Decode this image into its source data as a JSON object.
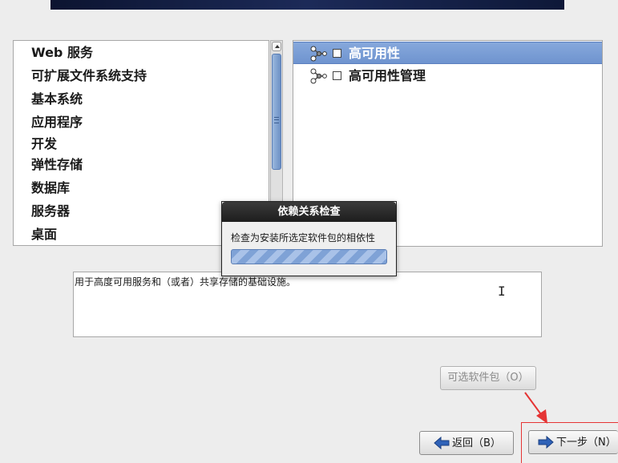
{
  "categories": [
    "Web 服务",
    "可扩展文件系统支持",
    "基本系统",
    "应用程序",
    "开发",
    "弹性存储",
    "数据库",
    "服务器",
    "桌面"
  ],
  "packages": [
    {
      "label": "高可用性",
      "selected": true,
      "checked": false,
      "icon": "package-group-icon"
    },
    {
      "label": "高可用性管理",
      "selected": false,
      "checked": false,
      "icon": "package-group-icon"
    }
  ],
  "description": "用于高度可用服务和（或者）共享存储的基础设施。",
  "dialog": {
    "title": "依赖关系检查",
    "message": "检查为安装所选定软件包的相依性",
    "progress": "indeterminate"
  },
  "buttons": {
    "optional": "可选软件包（O）",
    "back": "返回（B）",
    "next": "下一步（N）"
  },
  "colors": {
    "selection": "#6f94cf",
    "annotation": "#e53434"
  }
}
